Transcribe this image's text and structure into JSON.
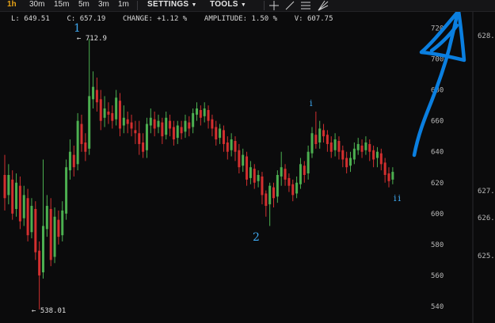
{
  "toolbar": {
    "timeframes": [
      "1h",
      "30m",
      "15m",
      "5m",
      "3m",
      "1m"
    ],
    "active_timeframe": "1h",
    "settings_label": "SETTINGS",
    "tools_label": "TOOLS",
    "icons": [
      "crosshair-icon",
      "line-tool-icon",
      "horizontal-lines-icon",
      "fib-fan-icon"
    ]
  },
  "stats": {
    "low": "L: 649.51",
    "close": "C: 657.19",
    "change": "CHANGE: +1.12 %",
    "amplitude": "AMPLITUDE: 1.50 %",
    "volume": "V: 607.75"
  },
  "price_axis": [
    "720",
    "700",
    "680",
    "660",
    "640",
    "620",
    "600",
    "580",
    "560",
    "540"
  ],
  "right_axis": [
    "628.",
    "627.",
    "626.",
    "625."
  ],
  "markers": {
    "high": "← 712.9",
    "low": "← 538.01"
  },
  "wave_labels": [
    "1",
    "2",
    "i",
    "ii"
  ],
  "colors": {
    "up": "#4caf50",
    "down": "#d32f2f",
    "annotation": "#0a7fe0",
    "wave": "#3ea8f0",
    "active": "#e8a317"
  },
  "chart_data": {
    "type": "candlestick",
    "ylim": [
      530,
      735
    ],
    "series": [
      {
        "o": 625,
        "c": 610,
        "h": 638,
        "l": 602
      },
      {
        "o": 612,
        "c": 625,
        "h": 632,
        "l": 606
      },
      {
        "o": 622,
        "c": 600,
        "h": 628,
        "l": 596
      },
      {
        "o": 603,
        "c": 620,
        "h": 626,
        "l": 598
      },
      {
        "o": 618,
        "c": 595,
        "h": 624,
        "l": 590
      },
      {
        "o": 597,
        "c": 612,
        "h": 618,
        "l": 592
      },
      {
        "o": 610,
        "c": 586,
        "h": 616,
        "l": 582
      },
      {
        "o": 588,
        "c": 605,
        "h": 610,
        "l": 584
      },
      {
        "o": 603,
        "c": 575,
        "h": 608,
        "l": 570
      },
      {
        "o": 576,
        "c": 560,
        "h": 582,
        "l": 538
      },
      {
        "o": 562,
        "c": 592,
        "h": 635,
        "l": 558
      },
      {
        "o": 590,
        "c": 605,
        "h": 612,
        "l": 585
      },
      {
        "o": 603,
        "c": 570,
        "h": 610,
        "l": 566
      },
      {
        "o": 572,
        "c": 598,
        "h": 604,
        "l": 568
      },
      {
        "o": 596,
        "c": 585,
        "h": 602,
        "l": 580
      },
      {
        "o": 586,
        "c": 602,
        "h": 608,
        "l": 582
      },
      {
        "o": 600,
        "c": 630,
        "h": 635,
        "l": 596
      },
      {
        "o": 628,
        "c": 640,
        "h": 648,
        "l": 622
      },
      {
        "o": 638,
        "c": 630,
        "h": 644,
        "l": 624
      },
      {
        "o": 632,
        "c": 660,
        "h": 665,
        "l": 628
      },
      {
        "o": 658,
        "c": 645,
        "h": 664,
        "l": 640
      },
      {
        "o": 646,
        "c": 640,
        "h": 652,
        "l": 634
      },
      {
        "o": 642,
        "c": 676,
        "h": 713,
        "l": 638
      },
      {
        "o": 674,
        "c": 682,
        "h": 692,
        "l": 668
      },
      {
        "o": 680,
        "c": 672,
        "h": 688,
        "l": 666
      },
      {
        "o": 674,
        "c": 660,
        "h": 680,
        "l": 654
      },
      {
        "o": 662,
        "c": 668,
        "h": 676,
        "l": 656
      },
      {
        "o": 666,
        "c": 664,
        "h": 672,
        "l": 658
      },
      {
        "o": 665,
        "c": 660,
        "h": 670,
        "l": 655
      },
      {
        "o": 661,
        "c": 675,
        "h": 680,
        "l": 657
      },
      {
        "o": 673,
        "c": 655,
        "h": 678,
        "l": 650
      },
      {
        "o": 657,
        "c": 662,
        "h": 670,
        "l": 652
      },
      {
        "o": 661,
        "c": 658,
        "h": 666,
        "l": 652
      },
      {
        "o": 659,
        "c": 655,
        "h": 664,
        "l": 650
      },
      {
        "o": 654,
        "c": 652,
        "h": 660,
        "l": 645
      },
      {
        "o": 652,
        "c": 645,
        "h": 660,
        "l": 638
      },
      {
        "o": 646,
        "c": 640,
        "h": 652,
        "l": 636
      },
      {
        "o": 641,
        "c": 658,
        "h": 662,
        "l": 636
      },
      {
        "o": 657,
        "c": 662,
        "h": 668,
        "l": 652
      },
      {
        "o": 661,
        "c": 655,
        "h": 666,
        "l": 650
      },
      {
        "o": 656,
        "c": 660,
        "h": 664,
        "l": 652
      },
      {
        "o": 659,
        "c": 650,
        "h": 662,
        "l": 645
      },
      {
        "o": 651,
        "c": 662,
        "h": 666,
        "l": 648
      },
      {
        "o": 660,
        "c": 655,
        "h": 664,
        "l": 650
      },
      {
        "o": 656,
        "c": 648,
        "h": 660,
        "l": 644
      },
      {
        "o": 649,
        "c": 657,
        "h": 660,
        "l": 645
      },
      {
        "o": 656,
        "c": 652,
        "h": 660,
        "l": 648
      },
      {
        "o": 653,
        "c": 660,
        "h": 664,
        "l": 649
      },
      {
        "o": 659,
        "c": 655,
        "h": 663,
        "l": 650
      },
      {
        "o": 656,
        "c": 665,
        "h": 668,
        "l": 652
      },
      {
        "o": 664,
        "c": 668,
        "h": 672,
        "l": 660
      },
      {
        "o": 667,
        "c": 662,
        "h": 670,
        "l": 657
      },
      {
        "o": 663,
        "c": 668,
        "h": 672,
        "l": 659
      },
      {
        "o": 667,
        "c": 660,
        "h": 670,
        "l": 655
      },
      {
        "o": 661,
        "c": 655,
        "h": 664,
        "l": 650
      },
      {
        "o": 656,
        "c": 648,
        "h": 660,
        "l": 644
      },
      {
        "o": 649,
        "c": 655,
        "h": 658,
        "l": 645
      },
      {
        "o": 654,
        "c": 645,
        "h": 657,
        "l": 640
      },
      {
        "o": 646,
        "c": 640,
        "h": 650,
        "l": 635
      },
      {
        "o": 641,
        "c": 648,
        "h": 652,
        "l": 637
      },
      {
        "o": 647,
        "c": 640,
        "h": 650,
        "l": 634
      },
      {
        "o": 641,
        "c": 630,
        "h": 645,
        "l": 626
      },
      {
        "o": 631,
        "c": 638,
        "h": 642,
        "l": 627
      },
      {
        "o": 637,
        "c": 622,
        "h": 640,
        "l": 618
      },
      {
        "o": 623,
        "c": 630,
        "h": 634,
        "l": 619
      },
      {
        "o": 629,
        "c": 620,
        "h": 632,
        "l": 616
      },
      {
        "o": 621,
        "c": 625,
        "h": 628,
        "l": 617
      },
      {
        "o": 624,
        "c": 612,
        "h": 627,
        "l": 606
      },
      {
        "o": 613,
        "c": 605,
        "h": 615,
        "l": 598
      },
      {
        "o": 606,
        "c": 618,
        "h": 620,
        "l": 592
      },
      {
        "o": 617,
        "c": 610,
        "h": 620,
        "l": 604
      },
      {
        "o": 611,
        "c": 625,
        "h": 628,
        "l": 607
      },
      {
        "o": 624,
        "c": 630,
        "h": 640,
        "l": 618
      },
      {
        "o": 629,
        "c": 622,
        "h": 632,
        "l": 618
      },
      {
        "o": 623,
        "c": 618,
        "h": 626,
        "l": 614
      },
      {
        "o": 619,
        "c": 612,
        "h": 622,
        "l": 608
      },
      {
        "o": 613,
        "c": 620,
        "h": 624,
        "l": 610
      },
      {
        "o": 619,
        "c": 632,
        "h": 636,
        "l": 616
      },
      {
        "o": 631,
        "c": 625,
        "h": 634,
        "l": 620
      },
      {
        "o": 626,
        "c": 640,
        "h": 644,
        "l": 622
      },
      {
        "o": 639,
        "c": 652,
        "h": 656,
        "l": 636
      },
      {
        "o": 651,
        "c": 645,
        "h": 666,
        "l": 642
      },
      {
        "o": 646,
        "c": 655,
        "h": 660,
        "l": 642
      },
      {
        "o": 654,
        "c": 650,
        "h": 658,
        "l": 646
      },
      {
        "o": 651,
        "c": 645,
        "h": 654,
        "l": 640
      },
      {
        "o": 646,
        "c": 640,
        "h": 650,
        "l": 636
      },
      {
        "o": 641,
        "c": 648,
        "h": 652,
        "l": 637
      },
      {
        "o": 647,
        "c": 640,
        "h": 650,
        "l": 635
      },
      {
        "o": 641,
        "c": 635,
        "h": 644,
        "l": 630
      },
      {
        "o": 636,
        "c": 630,
        "h": 640,
        "l": 626
      },
      {
        "o": 631,
        "c": 636,
        "h": 640,
        "l": 627
      },
      {
        "o": 635,
        "c": 642,
        "h": 646,
        "l": 632
      },
      {
        "o": 641,
        "c": 645,
        "h": 649,
        "l": 638
      },
      {
        "o": 644,
        "c": 640,
        "h": 648,
        "l": 636
      },
      {
        "o": 641,
        "c": 646,
        "h": 650,
        "l": 638
      },
      {
        "o": 645,
        "c": 640,
        "h": 648,
        "l": 634
      },
      {
        "o": 641,
        "c": 635,
        "h": 644,
        "l": 630
      },
      {
        "o": 636,
        "c": 640,
        "h": 643,
        "l": 630
      },
      {
        "o": 639,
        "c": 632,
        "h": 642,
        "l": 628
      },
      {
        "o": 633,
        "c": 625,
        "h": 636,
        "l": 620
      },
      {
        "o": 626,
        "c": 621,
        "h": 630,
        "l": 617
      },
      {
        "o": 622,
        "c": 627,
        "h": 630,
        "l": 619
      }
    ]
  }
}
